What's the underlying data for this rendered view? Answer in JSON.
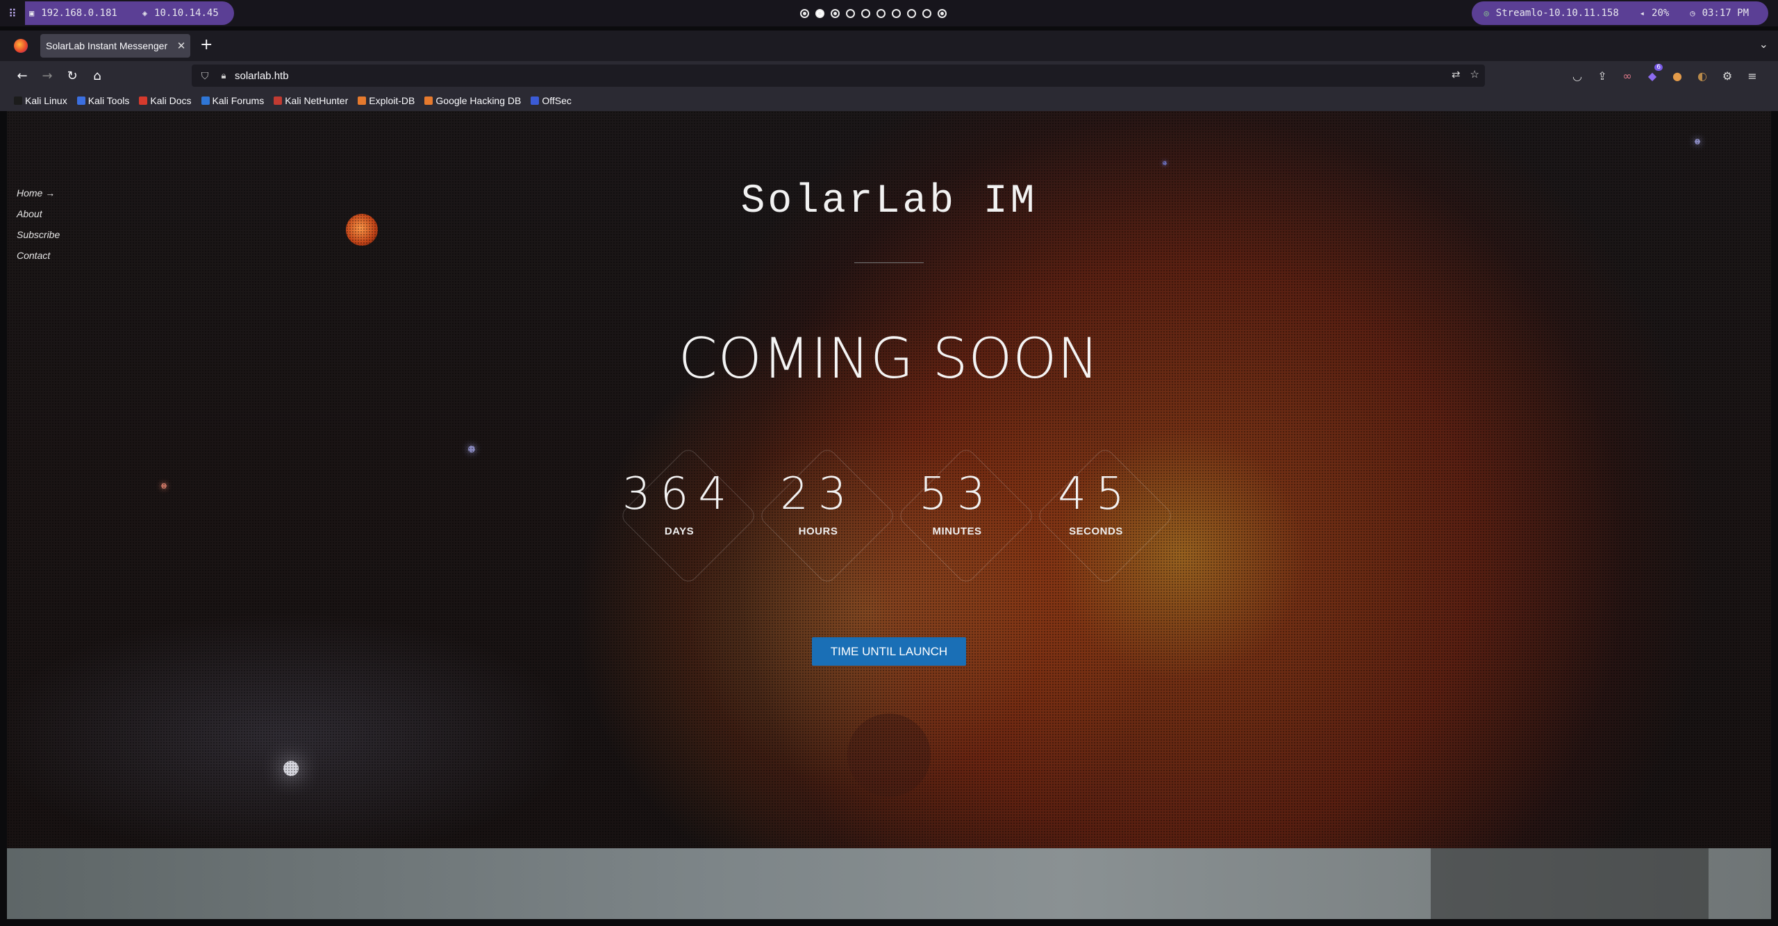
{
  "system_bar": {
    "left_ips": [
      "192.168.0.181",
      "10.10.14.45"
    ],
    "workspace_count": 10,
    "active_workspace": 2,
    "right_items": {
      "target": "Streamlo-10.10.11.158",
      "volume": "20%",
      "clock": "03:17 PM"
    }
  },
  "browser": {
    "tab_title": "SolarLab Instant Messenger",
    "url": "solarlab.htb",
    "bookmarks": [
      "Kali Linux",
      "Kali Tools",
      "Kali Docs",
      "Kali Forums",
      "Kali NetHunter",
      "Exploit-DB",
      "Google Hacking DB",
      "OffSec"
    ],
    "bookmark_colors": [
      "#1c1c1c",
      "#3b6fe0",
      "#d63a2d",
      "#2f76d6",
      "#c23b32",
      "#e67a2e",
      "#e67a2e",
      "#3b5bd6"
    ],
    "extension_badge": "6"
  },
  "page": {
    "nav": [
      "Home →",
      "About",
      "Subscribe",
      "Contact"
    ],
    "title": "SolarLab IM",
    "headline": "COMING SOON",
    "countdown": [
      {
        "value": "364",
        "label": "DAYS"
      },
      {
        "value": "23",
        "label": "HOURS"
      },
      {
        "value": "53",
        "label": "MINUTES"
      },
      {
        "value": "45",
        "label": "SECONDS"
      }
    ],
    "button": "TIME UNTIL LAUNCH"
  }
}
